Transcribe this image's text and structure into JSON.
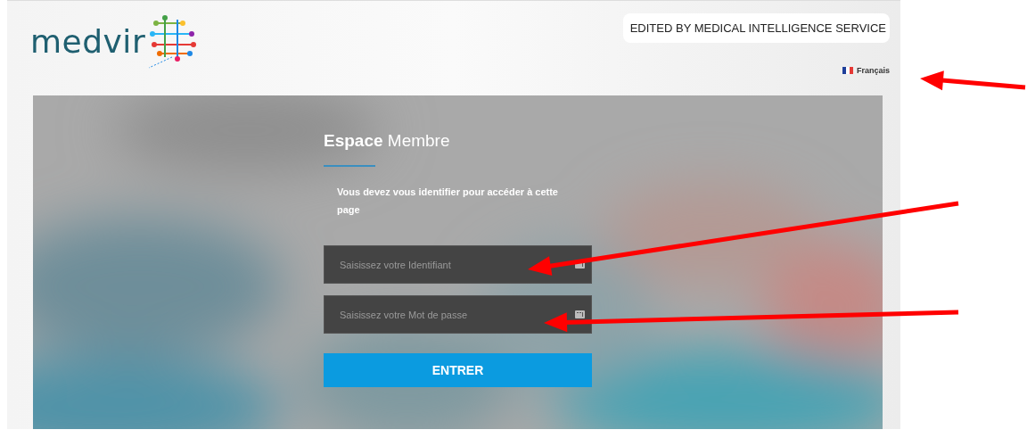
{
  "header": {
    "logo": "medvir",
    "editor_badge": "EDITED BY MEDICAL INTELLIGENCE SERVICE",
    "language": "Français"
  },
  "login": {
    "title": "**Espace** Membre",
    "message": "Vous devez vous identifier pour accéder à cette page",
    "fields": [
      {
        "placeholder": "Saisissez votre Identifiant"
      },
      {
        "placeholder": "Saisissez votre Mot de passe"
      }
    ],
    "submit": "ENTRER"
  }
}
